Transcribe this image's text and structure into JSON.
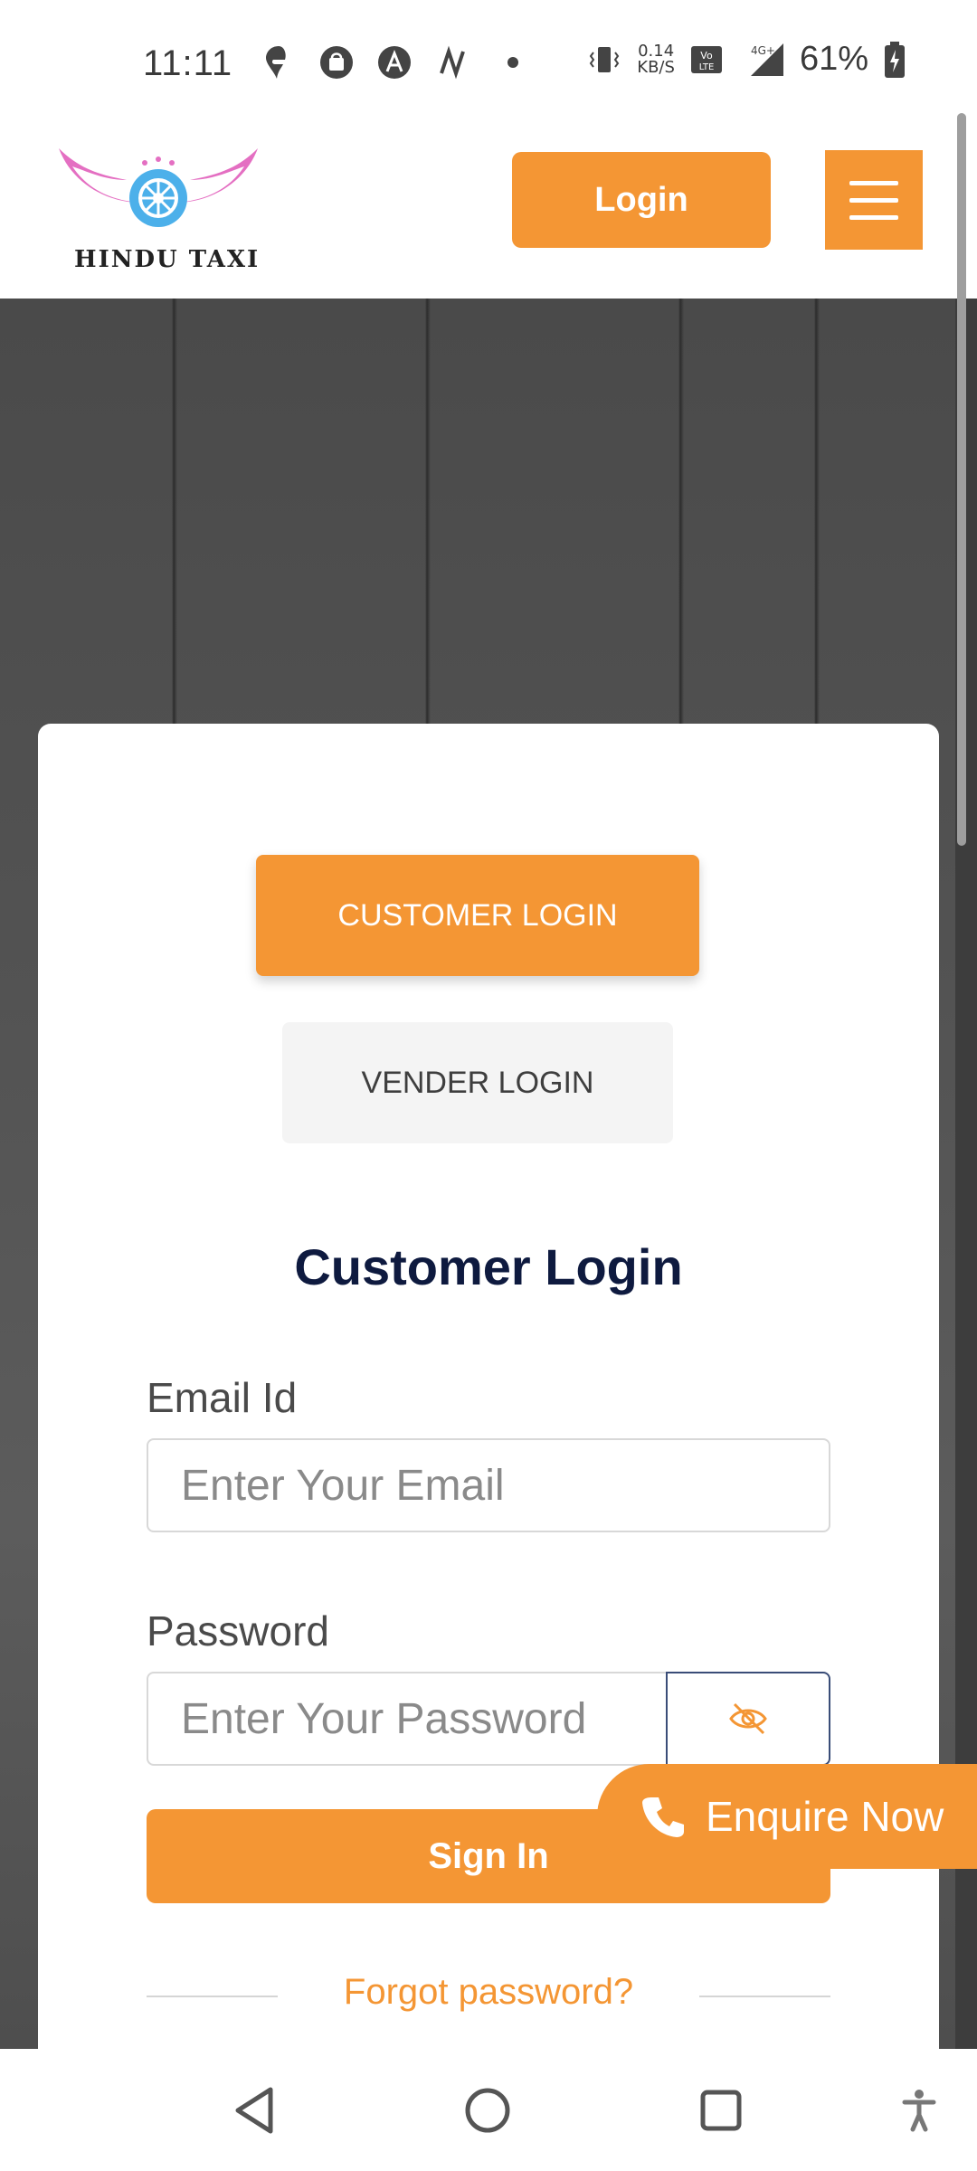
{
  "status_bar": {
    "time": "11:11",
    "net_speed_value": "0.14",
    "net_speed_unit": "KB/S",
    "network": "4G",
    "battery": "61%"
  },
  "header": {
    "logo_text": "HINDU TAXI",
    "login_label": "Login",
    "menu_icon": "hamburger-icon"
  },
  "card": {
    "customer_login_tab": "CUSTOMER LOGIN",
    "vender_login_tab": "VENDER LOGIN",
    "title": "Customer Login",
    "email_label": "Email Id",
    "email_placeholder": "Enter Your Email",
    "password_label": "Password",
    "password_placeholder": "Enter Your Password",
    "signin_label": "Sign In",
    "forgot_label": "Forgot password?"
  },
  "floating": {
    "enquire_label": "Enquire Now"
  },
  "colors": {
    "accent": "#f49634",
    "title": "#0e1a3f"
  }
}
